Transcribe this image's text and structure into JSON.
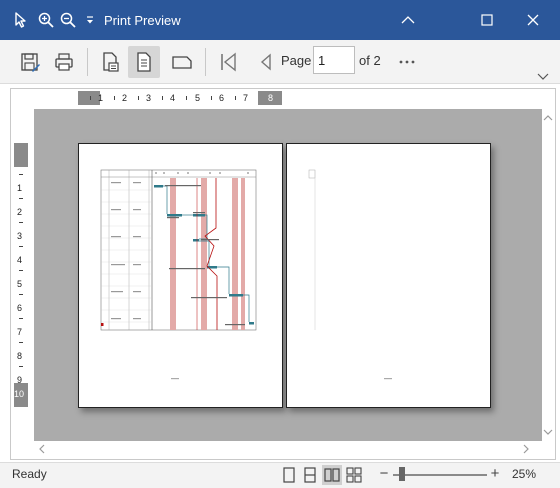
{
  "window": {
    "title": "Print Preview",
    "controls": [
      "minimize-icon",
      "maximize-icon",
      "close-icon"
    ]
  },
  "titlebar_tools": [
    "select-cursor-icon",
    "zoom-in-icon",
    "zoom-out-icon",
    "customize-dropdown-icon"
  ],
  "toolbar": {
    "buttons": [
      "save-icon",
      "print-icon",
      "page-setup-icon",
      "portrait-icon",
      "landscape-icon",
      "first-page-icon",
      "previous-page-icon",
      "more-icon"
    ],
    "page_label": "Page",
    "page_value": "1",
    "of_label": "of 2"
  },
  "ruler": {
    "horizontal_labels": [
      "1",
      "2",
      "3",
      "4",
      "5",
      "6",
      "7",
      "8"
    ],
    "vertical_labels": [
      "1",
      "2",
      "3",
      "4",
      "5",
      "6",
      "7",
      "8",
      "9",
      "10"
    ]
  },
  "status": {
    "text": "Ready",
    "view_modes": [
      "single-page-view-icon",
      "two-page-vertical-view-icon",
      "two-page-view-icon",
      "multi-page-view-icon"
    ],
    "active_view": "two-page-view-icon",
    "zoom": "25%",
    "zoom_level_percent": 25
  },
  "colors": {
    "titlebar": "#2b579a",
    "canvas": "#ababab",
    "gantt_highlight": "#e3aaa8",
    "task_bar": "#2f7a8a",
    "dependency_line": "#b80f0f"
  }
}
